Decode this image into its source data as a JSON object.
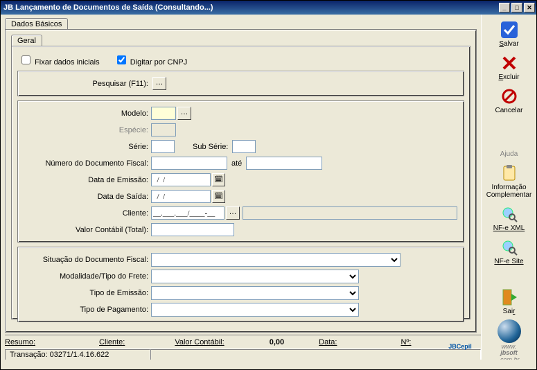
{
  "window": {
    "title_prefix": "JB",
    "title": "Lançamento de Documentos de Saída (Consultando...)"
  },
  "tabs": {
    "main": "Dados Básicos",
    "inner": "Geral"
  },
  "checkboxes": {
    "fixar": {
      "label": "Fixar dados iniciais",
      "checked": false
    },
    "digitar_cnpj": {
      "label": "Digitar por CNPJ",
      "checked": true
    }
  },
  "group1": {
    "pesquisar_label": "Pesquisar (F11):"
  },
  "group2": {
    "modelo_label": "Modelo:",
    "modelo_value": "",
    "especie_label": "Espécie:",
    "especie_value": "",
    "serie_label": "Série:",
    "serie_value": "",
    "subserie_label": "Sub Série:",
    "subserie_value": "",
    "numdoc_label": "Número do Documento Fiscal:",
    "numdoc_from": "",
    "ate_label": "até",
    "numdoc_to": "",
    "emissao_label": "Data de Emissão:",
    "emissao_value": "  /  /",
    "saida_label": "Data de Saída:",
    "saida_value": "  /  /",
    "cliente_label": "Cliente:",
    "cliente_value": "__.___.___/____-__",
    "valor_label": "Valor Contábil (Total):",
    "valor_value": ""
  },
  "group3": {
    "situacao_label": "Situação do Documento Fiscal:",
    "situacao_value": "",
    "modalidade_label": "Modalidade/Tipo do Frete:",
    "modalidade_value": "",
    "tipo_emissao_label": "Tipo de Emissão:",
    "tipo_emissao_value": "",
    "tipo_pag_label": "Tipo de Pagamento:",
    "tipo_pag_value": ""
  },
  "summary": {
    "resumo": "Resumo:",
    "cliente": "Cliente:",
    "valor_label": "Valor Contábil:",
    "valor_value": "0,00",
    "data": "Data:",
    "numero": "Nº:"
  },
  "status": {
    "transacao": "Transação: 03271/1.4.16.622"
  },
  "sidebar": {
    "salvar": "Salvar",
    "excluir": "Excluir",
    "cancelar": "Cancelar",
    "ajuda": "Ajuda",
    "info": "Informação Complementar",
    "nfe_xml": "NF-e XML",
    "nfe_site": "NF-e Site",
    "sair": "Sair",
    "brand": "JBCepil",
    "url1": "www.",
    "url2": "jbsoft",
    "url3": ".com.br"
  }
}
